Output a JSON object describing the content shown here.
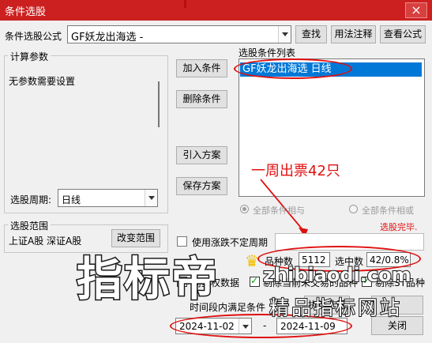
{
  "window": {
    "title": "条件选股",
    "close": "×"
  },
  "formula": {
    "label": "条件选股公式",
    "value": "GF妖龙出海选  -"
  },
  "buttons": {
    "find": "查找",
    "usage": "用法注释",
    "view": "查看公式",
    "add": "加入条件",
    "delete": "删除条件",
    "import": "引入方案",
    "save": "保存方案",
    "change_range": "改变范围",
    "execute": "执行选股",
    "close": "关闭"
  },
  "params": {
    "title": "计算参数",
    "text": "无参数需要设置"
  },
  "period": {
    "label": "选股周期:",
    "value": "日线"
  },
  "list": {
    "title": "选股条件列表",
    "items": [
      "GF妖龙出海选  日线"
    ]
  },
  "annotation": "一周出票42只",
  "logic": {
    "and": "全部条件相与",
    "or": "全部条件相或"
  },
  "range": {
    "title": "选股范围",
    "value": "上证A股 深证A股"
  },
  "status": "选股完毕.",
  "options": {
    "variable_period": "使用涨跌不定周期",
    "prev_rights": "前复权数据",
    "exclude_suspend": "剔除当前未交易的品种",
    "exclude_st": "剔除ST品种"
  },
  "counts": {
    "total_label": "品种数",
    "total": "5112",
    "selected_label": "选中数",
    "selected": "42/0.8%"
  },
  "time": {
    "label": "时间段内满足条件",
    "start": "2024-11-02",
    "sep": "-",
    "end": "2024-11-09"
  },
  "watermark": {
    "big": "指标帝",
    "url": "zhibiaodi.com",
    "sub": "精品指标网站"
  },
  "colors": {
    "title_bar": "#cc2020",
    "highlight": "#0078d7",
    "annotation": "#e01010"
  }
}
